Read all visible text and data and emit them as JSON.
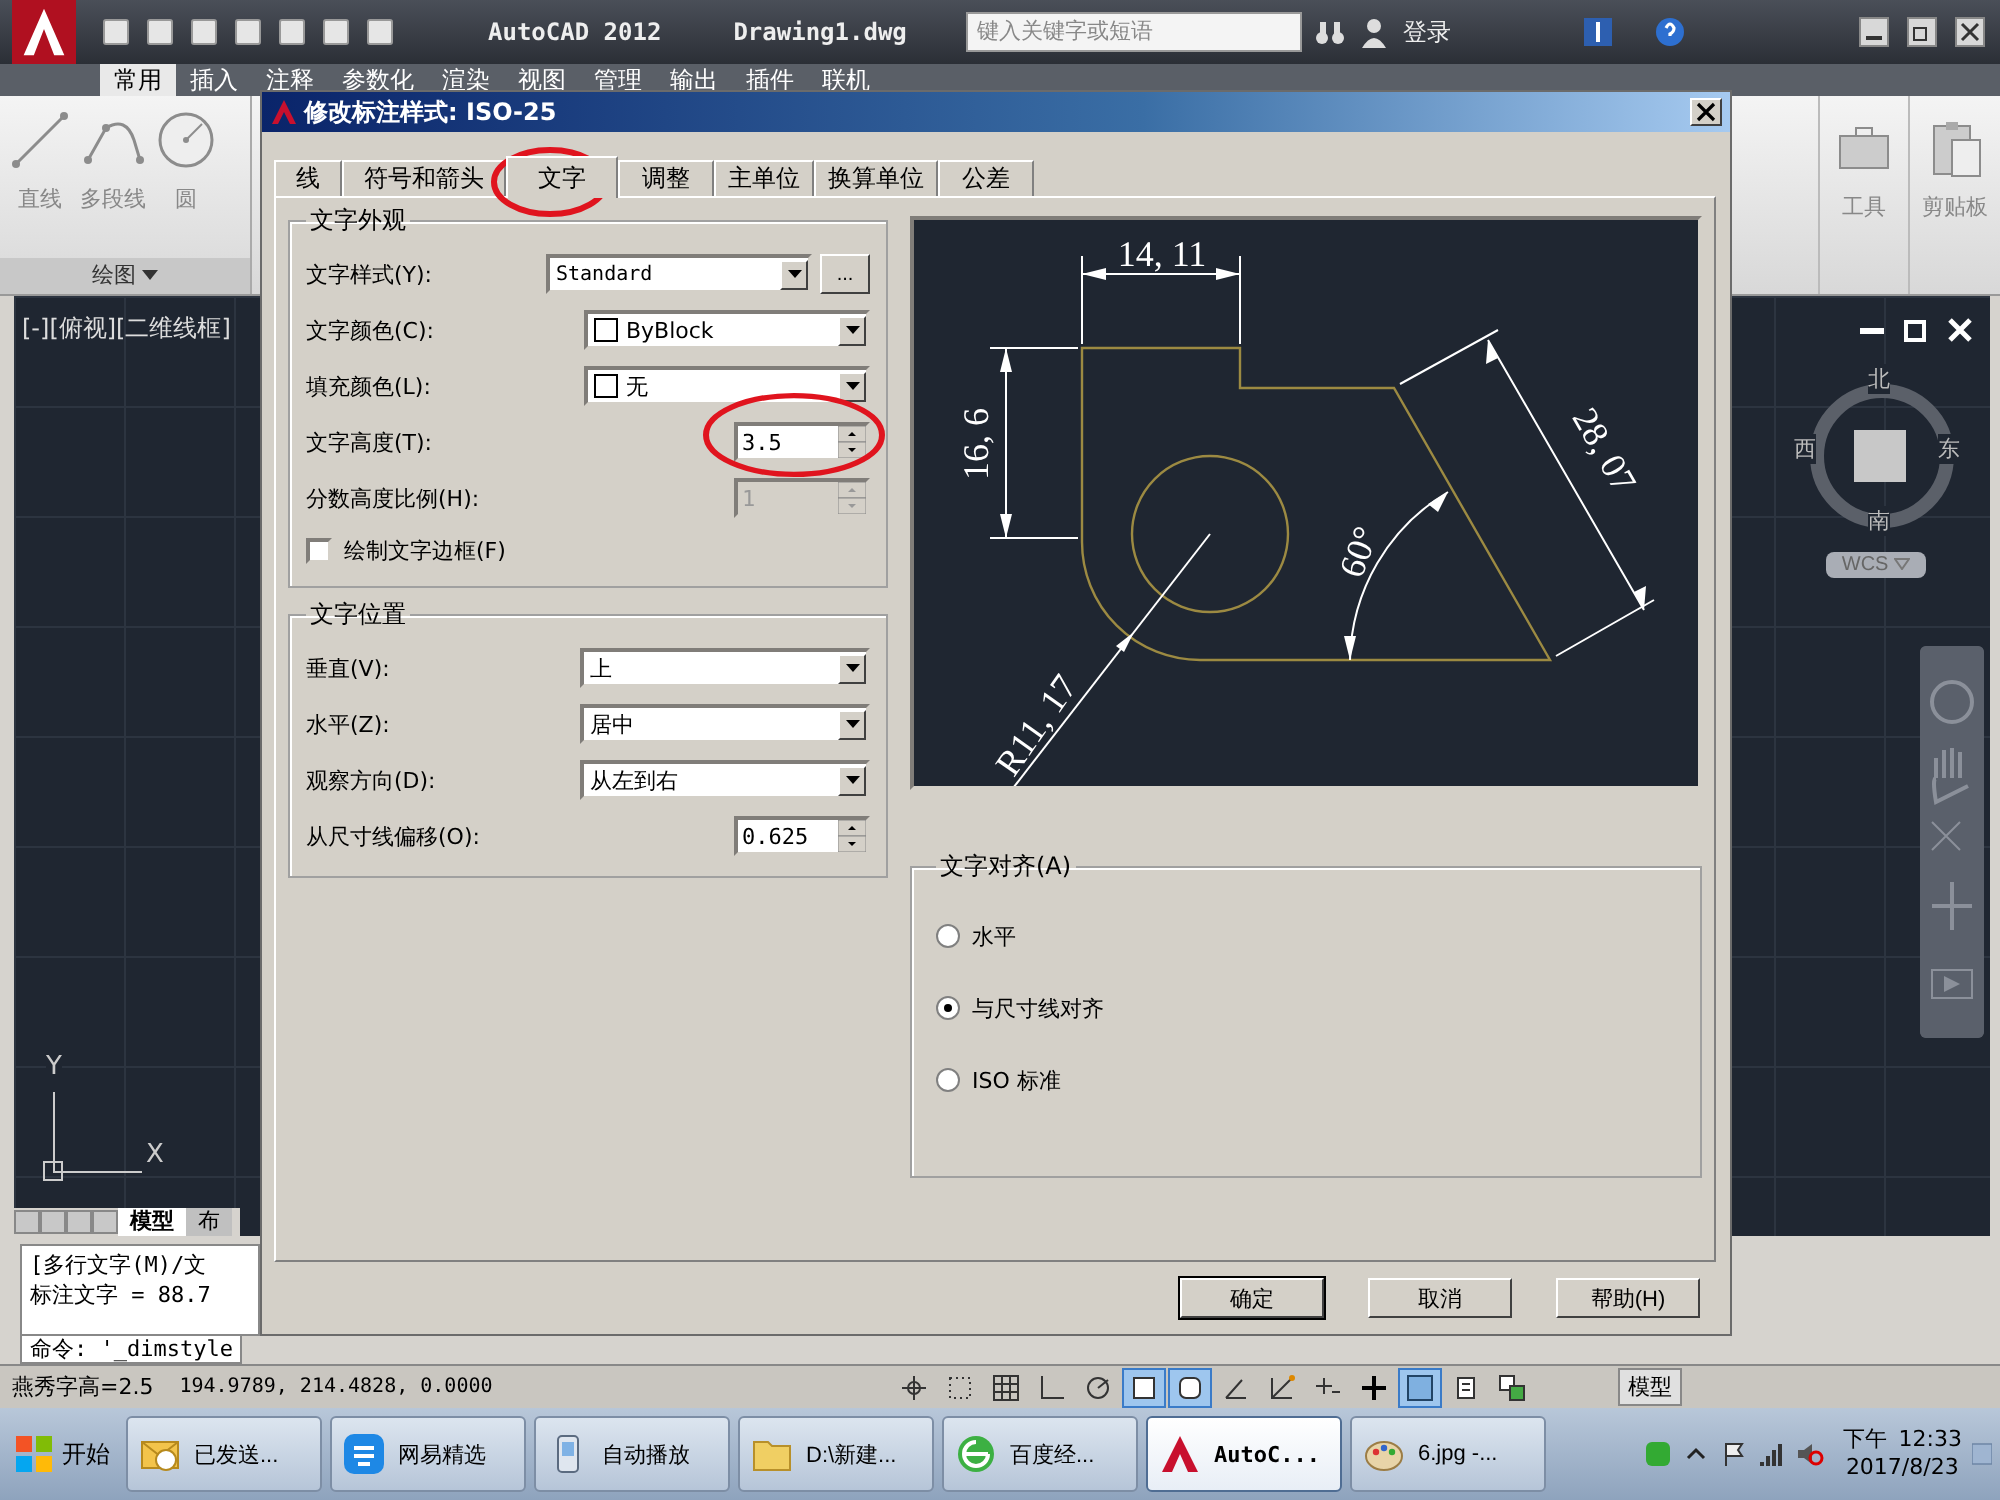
{
  "app": {
    "title": "AutoCAD 2012",
    "document": "Drawing1.dwg",
    "search_placeholder": "键入关键字或短语",
    "sign_in": "登录"
  },
  "ribbon_tabs": [
    {
      "label": "常用",
      "selected": true
    },
    {
      "label": "插入",
      "selected": false
    },
    {
      "label": "注释",
      "selected": false
    },
    {
      "label": "参数化",
      "selected": false
    },
    {
      "label": "渲染",
      "selected": false
    },
    {
      "label": "视图",
      "selected": false
    },
    {
      "label": "管理",
      "selected": false
    },
    {
      "label": "输出",
      "selected": false
    },
    {
      "label": "插件",
      "selected": false
    },
    {
      "label": "联机",
      "selected": false
    }
  ],
  "ribbon_tools": [
    {
      "kind": "line",
      "label": "直线"
    },
    {
      "kind": "polyline",
      "label": "多段线"
    },
    {
      "kind": "circle",
      "label": "圆"
    }
  ],
  "ribbon_panel_label": "绘图",
  "ribbon_right": [
    {
      "kind": "tools",
      "label": "工具"
    },
    {
      "kind": "clipboard",
      "label": "剪贴板"
    }
  ],
  "viewport_label": "[-][俯视][二维线框]",
  "viewcube": {
    "north": "北",
    "west": "西",
    "east": "东",
    "south": "南",
    "ucs": "WCS"
  },
  "ucs_icon": {
    "y": "Y",
    "x": "X"
  },
  "layout_tabs": [
    {
      "label": "模型",
      "selected": true
    },
    {
      "label": "布",
      "selected": false
    }
  ],
  "command_lines": [
    "[多行文字(M)/文",
    "标注文字 = 88.7"
  ],
  "command_prompt": "命令: '_dimstyle",
  "status_bar": {
    "info": "燕秀字高=2.5",
    "coordinates": "194.9789, 214.4828, 0.0000",
    "space": "模型",
    "toggles": [
      {
        "on": false
      },
      {
        "on": false
      },
      {
        "on": false
      },
      {
        "on": false
      },
      {
        "on": false
      },
      {
        "on": true
      },
      {
        "on": true
      },
      {
        "on": false
      },
      {
        "on": false
      },
      {
        "on": false
      },
      {
        "on": false
      },
      {
        "on": true
      },
      {
        "on": false
      },
      {
        "on": false
      }
    ]
  },
  "taskbar": {
    "start": "开始",
    "items": [
      {
        "kind": "mail",
        "label": "已发送...",
        "selected": false
      },
      {
        "kind": "app",
        "label": "网易精选",
        "selected": false
      },
      {
        "kind": "device",
        "label": "自动播放",
        "selected": false
      },
      {
        "kind": "folder",
        "label": "D:\\新建...",
        "selected": false
      },
      {
        "kind": "browser",
        "label": "百度经...",
        "selected": false
      },
      {
        "kind": "autocad",
        "label": "AutoC...",
        "selected": true
      },
      {
        "kind": "paint",
        "label": "6.jpg -...",
        "selected": false
      }
    ],
    "period": "下午",
    "time": "12:33",
    "date": "2017/8/23"
  },
  "dialog": {
    "title": "修改标注样式: ISO-25",
    "tabs": [
      {
        "label": "线",
        "selected": false
      },
      {
        "label": "符号和箭头",
        "selected": false
      },
      {
        "label": "文字",
        "selected": true
      },
      {
        "label": "调整",
        "selected": false
      },
      {
        "label": "主单位",
        "selected": false
      },
      {
        "label": "换算单位",
        "selected": false
      },
      {
        "label": "公差",
        "selected": false
      }
    ],
    "text_appearance": {
      "legend": "文字外观",
      "rows": [
        {
          "kind": "dropdown_browse",
          "label": "文字样式(Y):",
          "value": "Standard",
          "browse": "...",
          "disabled": false
        },
        {
          "kind": "color",
          "label": "文字颜色(C):",
          "value": "ByBlock",
          "disabled": false
        },
        {
          "kind": "color",
          "label": "填充颜色(L):",
          "value": "无",
          "disabled": false
        },
        {
          "kind": "spinner",
          "label": "文字高度(T):",
          "value": "3.5",
          "disabled": false
        },
        {
          "kind": "spinner",
          "label": "分数高度比例(H):",
          "value": "1",
          "disabled": true
        }
      ],
      "frame_checkbox": {
        "label": "绘制文字边框(F)",
        "checked": false
      }
    },
    "text_placement": {
      "legend": "文字位置",
      "rows": [
        {
          "kind": "dropdown",
          "label": "垂直(V):",
          "value": "上",
          "disabled": false
        },
        {
          "kind": "dropdown",
          "label": "水平(Z):",
          "value": "居中",
          "disabled": false
        },
        {
          "kind": "dropdown",
          "label": "观察方向(D):",
          "value": "从左到右",
          "disabled": false
        },
        {
          "kind": "spinner",
          "label": "从尺寸线偏移(O):",
          "value": "0.625",
          "disabled": false
        }
      ]
    },
    "preview": {
      "labels": [
        "14, 11",
        "16, 6",
        "28, 07",
        "60°",
        "R11, 17"
      ]
    },
    "text_alignment": {
      "legend": "文字对齐(A)",
      "options": [
        {
          "label": "水平",
          "selected": false
        },
        {
          "label": "与尺寸线对齐",
          "selected": true
        },
        {
          "label": "ISO 标准",
          "selected": false
        }
      ]
    },
    "buttons": [
      "确定",
      "取消",
      "帮助(H)"
    ]
  }
}
